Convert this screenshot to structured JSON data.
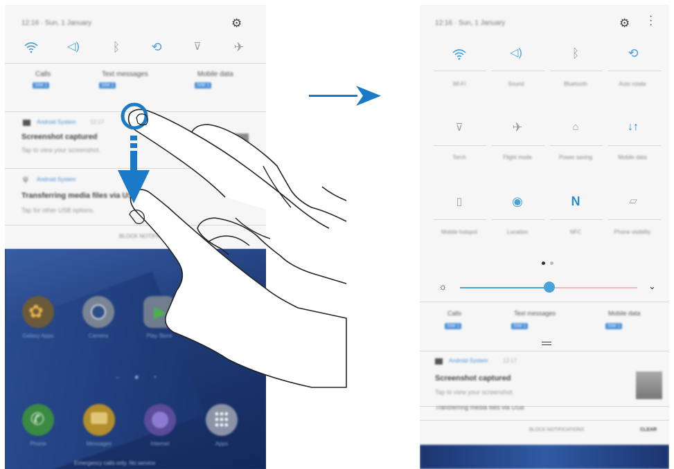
{
  "left_screen": {
    "status": {
      "time_date": "12:16 · Sun, 1 January"
    },
    "quick_icons": [
      "wifi-icon",
      "sound-icon",
      "bluetooth-icon",
      "auto-rotate-icon",
      "torch-icon",
      "airplane-icon"
    ],
    "sim_row": [
      {
        "label": "Calls",
        "sim": "SIM 1"
      },
      {
        "label": "Text messages",
        "sim": "SIM 1"
      },
      {
        "label": "Mobile data",
        "sim": "SIM 1"
      }
    ],
    "notification_1": {
      "app": "Android System",
      "time": "12:17",
      "title": "Screenshot captured",
      "body": "Tap to view your screenshot."
    },
    "notification_2": {
      "app": "Android System",
      "title": "Transferring media files via USB",
      "body": "Tap for other USB options."
    },
    "bottom_button": "BLOCK NOTIFICATIONS",
    "apps_row_1": [
      "Galaxy Apps",
      "Camera",
      "Play Store"
    ],
    "apps_row_2": [
      "Phone",
      "Messages",
      "Internet",
      "Apps"
    ],
    "emergency": "Emergency calls only. No service"
  },
  "right_screen": {
    "status": {
      "time_date": "12:16 · Sun, 1 January"
    },
    "tiles": [
      {
        "label": "Wi-Fi",
        "icon": "wifi-icon",
        "active": true
      },
      {
        "label": "Sound",
        "icon": "sound-icon",
        "active": true
      },
      {
        "label": "Bluetooth",
        "icon": "bluetooth-icon",
        "active": false
      },
      {
        "label": "Auto rotate",
        "icon": "auto-rotate-icon",
        "active": true
      },
      {
        "label": "Torch",
        "icon": "torch-icon",
        "active": false
      },
      {
        "label": "Flight mode",
        "icon": "airplane-icon",
        "active": false
      },
      {
        "label": "Power saving",
        "icon": "battery-icon",
        "active": false
      },
      {
        "label": "Mobile data",
        "icon": "data-arrows-icon",
        "active": true
      },
      {
        "label": "Mobile hotspot",
        "icon": "hotspot-icon",
        "active": false
      },
      {
        "label": "Location",
        "icon": "location-icon",
        "active": true
      },
      {
        "label": "NFC",
        "icon": "nfc-icon",
        "active": true
      },
      {
        "label": "Phone visibility",
        "icon": "phone-visibility-icon",
        "active": false
      }
    ],
    "brightness": {
      "level": 0.5
    },
    "sim_row": [
      {
        "label": "Calls",
        "sim": "SIM 1"
      },
      {
        "label": "Text messages",
        "sim": "SIM 1"
      },
      {
        "label": "Mobile data",
        "sim": "SIM 1"
      }
    ],
    "notification_1": {
      "app": "Android System",
      "time": "12:17",
      "title": "Screenshot captured",
      "body": "Tap to view your screenshot."
    },
    "notification_2_title": "Transferring media files via USB",
    "block_button": "BLOCK NOTIFICATIONS",
    "clear_button": "CLEAR"
  },
  "colors": {
    "accent": "#1a7ac7",
    "icon_active": "#4aa3d8",
    "wallpaper": "#1f3c78"
  }
}
